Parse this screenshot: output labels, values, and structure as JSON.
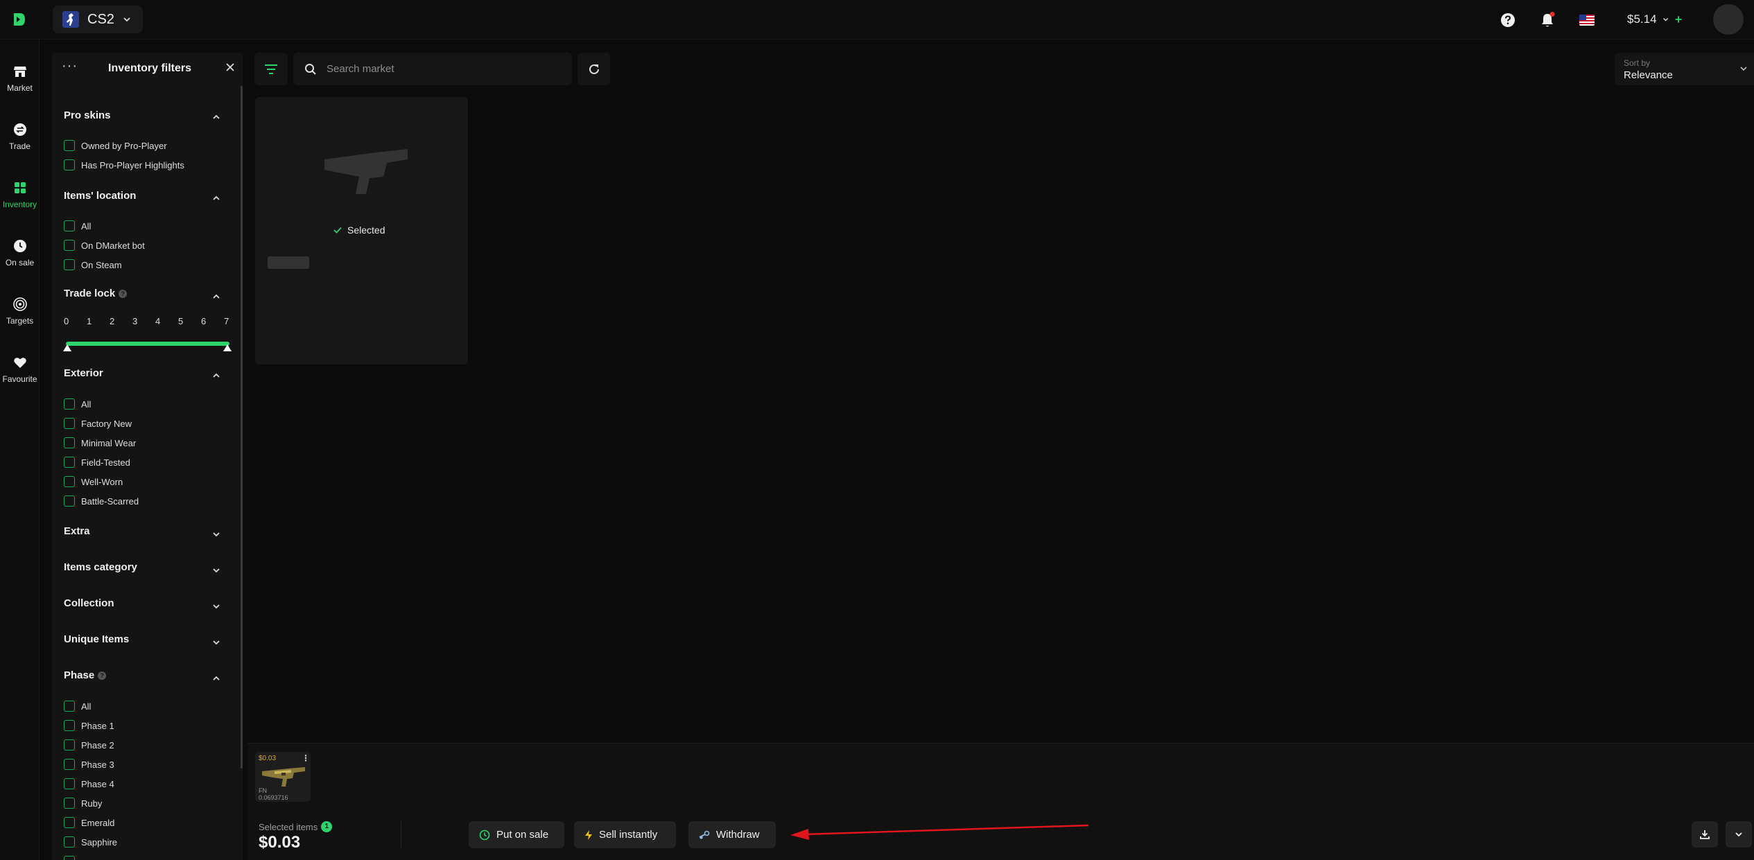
{
  "header": {
    "game": "CS2",
    "balance": "$5.14"
  },
  "rail": {
    "items": [
      {
        "label": "Market"
      },
      {
        "label": "Trade"
      },
      {
        "label": "Inventory"
      },
      {
        "label": "On sale"
      },
      {
        "label": "Targets"
      },
      {
        "label": "Favourite"
      }
    ],
    "active": "Inventory"
  },
  "filters": {
    "title": "Inventory filters",
    "menu": "···",
    "pro_skins": {
      "title": "Pro skins",
      "options": [
        "Owned by Pro-Player",
        "Has Pro-Player Highlights"
      ]
    },
    "location": {
      "title": "Items' location",
      "options": [
        "All",
        "On DMarket bot",
        "On Steam"
      ]
    },
    "trade_lock": {
      "title": "Trade lock",
      "ticks": [
        "0",
        "1",
        "2",
        "3",
        "4",
        "5",
        "6",
        "7"
      ],
      "range": [
        0,
        7
      ]
    },
    "exterior": {
      "title": "Exterior",
      "options": [
        "All",
        "Factory New",
        "Minimal Wear",
        "Field-Tested",
        "Well-Worn",
        "Battle-Scarred"
      ]
    },
    "extra": {
      "title": "Extra"
    },
    "category": {
      "title": "Items category"
    },
    "collection": {
      "title": "Collection"
    },
    "unique": {
      "title": "Unique Items"
    },
    "phase": {
      "title": "Phase",
      "options": [
        "All",
        "Phase 1",
        "Phase 2",
        "Phase 3",
        "Phase 4",
        "Ruby",
        "Emerald",
        "Sapphire"
      ]
    }
  },
  "toolbar": {
    "search_placeholder": "Search market",
    "sort_label": "Sort by",
    "sort_value": "Relevance"
  },
  "card": {
    "selected_label": "Selected"
  },
  "bottom": {
    "thumb_price": "$0.03",
    "thumb_exterior": "FN",
    "thumb_float": "0.0693716",
    "selected_label": "Selected items",
    "selected_count": "1",
    "selected_total": "$0.03",
    "put_on_sale": "Put on sale",
    "sell_instantly": "Sell instantly",
    "withdraw": "Withdraw"
  },
  "colors": {
    "accent": "#2fd36b",
    "background": "#0b0b0b",
    "panel": "#141414",
    "annotation_arrow": "#e0161c"
  }
}
